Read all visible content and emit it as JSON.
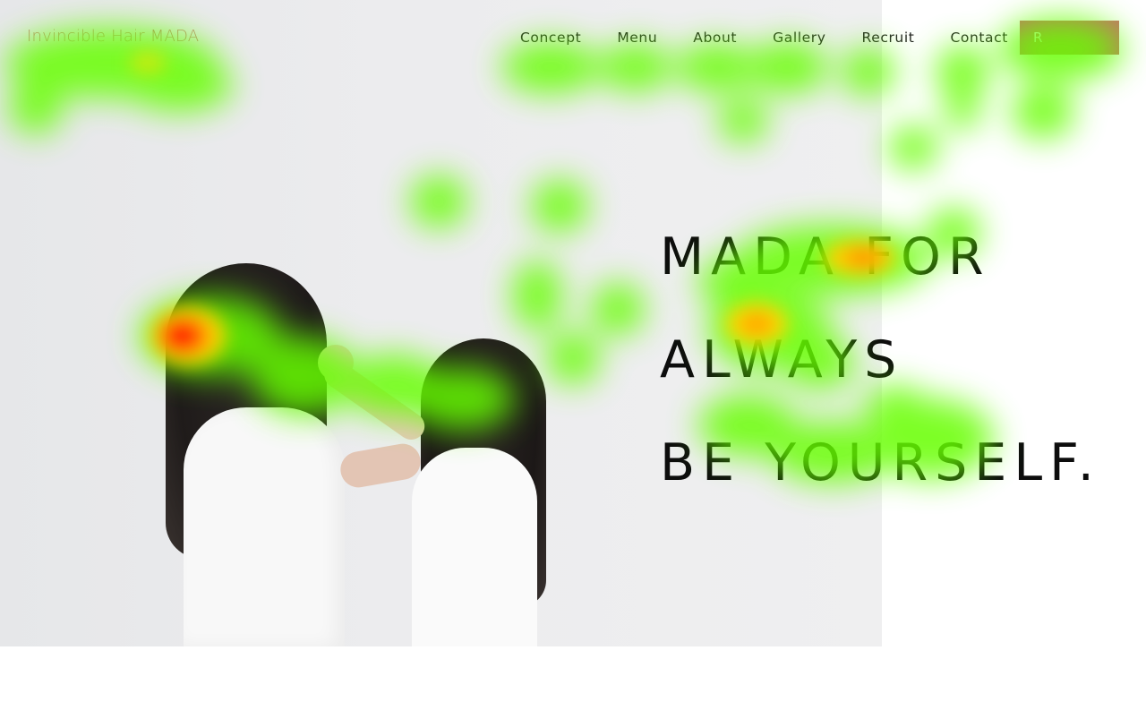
{
  "site": {
    "logo": "Invincible Hair MADA"
  },
  "nav": {
    "items": [
      {
        "label": "Concept"
      },
      {
        "label": "Menu"
      },
      {
        "label": "About"
      },
      {
        "label": "Gallery"
      },
      {
        "label": "Recruit"
      },
      {
        "label": "Contact"
      }
    ],
    "cta_label": "R"
  },
  "hero": {
    "lines": [
      "MADA FOR",
      "ALWAYS",
      "BE YOURSELF."
    ]
  },
  "colors": {
    "accent": "#c7716a",
    "logo": "#c97f7f",
    "text": "#0d0d0d"
  }
}
